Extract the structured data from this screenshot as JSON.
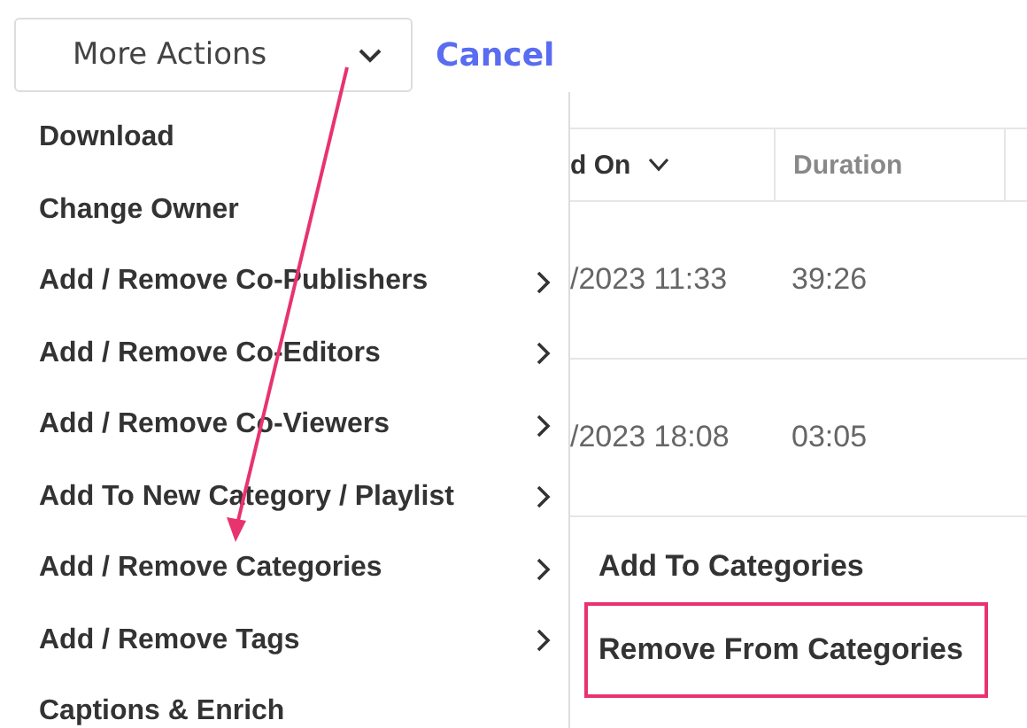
{
  "toolbar": {
    "actions_button": {
      "label": "More Actions"
    },
    "cancel_link": {
      "label": "Cancel"
    }
  },
  "menu": {
    "items": [
      {
        "label": "Download",
        "has_submenu": false
      },
      {
        "label": "Change Owner",
        "has_submenu": false
      },
      {
        "label": "Add / Remove Co-Publishers",
        "has_submenu": true
      },
      {
        "label": "Add / Remove Co-Editors",
        "has_submenu": true
      },
      {
        "label": "Add / Remove Co-Viewers",
        "has_submenu": true
      },
      {
        "label": "Add To New Category / Playlist",
        "has_submenu": true
      },
      {
        "label": "Add / Remove Categories",
        "has_submenu": true
      },
      {
        "label": "Add / Remove Tags",
        "has_submenu": true
      },
      {
        "label": "Captions & Enrich",
        "has_submenu": false
      }
    ]
  },
  "submenu": {
    "items": [
      {
        "label": "Add To Categories",
        "highlighted": false
      },
      {
        "label": "Remove From Categories",
        "highlighted": true
      }
    ]
  },
  "table": {
    "columns": [
      {
        "label": "d On",
        "sortable": true
      },
      {
        "label": "Duration",
        "sortable": false
      }
    ],
    "rows": [
      [
        "/2023 11:33",
        "39:26"
      ],
      [
        "/2023 18:08",
        "03:05"
      ]
    ]
  },
  "pointer_arrow": true
}
